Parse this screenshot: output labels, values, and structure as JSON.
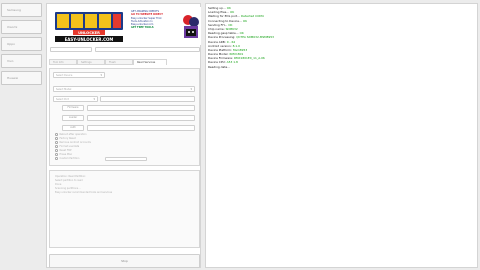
{
  "sidebar": {
    "items": [
      {
        "label": "Samsung"
      },
      {
        "label": "Xiaomi"
      },
      {
        "label": "Oppo"
      },
      {
        "label": "Vivo"
      },
      {
        "label": "Huawei"
      }
    ]
  },
  "banner": {
    "logo_text": "EASY",
    "logo_sub": "UNLOCKER",
    "logo_url": "EASY-UNLOCKER.COM",
    "promo_lines": [
      "GET AMAZING CREDITS",
      "GO TO WEBSITE DIRECT",
      "Easy unlocker Super Trick",
      "Tools Activation In",
      "Easy-unlocker.com"
    ],
    "promo_cta": "GET FREE TOOLS"
  },
  "tabs": {
    "items": [
      {
        "label": "Tool Info"
      },
      {
        "label": "Settings"
      },
      {
        "label": "Flash"
      },
      {
        "label": "Read Services"
      }
    ],
    "active_index": 3
  },
  "settings": {
    "dropdowns": [
      {
        "placeholder": "Select Device"
      },
      {
        "placeholder": "Select Model"
      },
      {
        "placeholder": "Select Port"
      }
    ],
    "buttons": [
      {
        "label": "Firmware"
      },
      {
        "label": "Loader"
      },
      {
        "label": "Auth"
      }
    ],
    "options": [
      {
        "label": "Reboot after operation"
      },
      {
        "label": "Factory Reset"
      },
      {
        "label": "Remove Android Accounts"
      },
      {
        "label": "Format userdata"
      },
      {
        "label": "Reset FRP"
      },
      {
        "label": "Erase Misc"
      },
      {
        "label": "Custom Partition"
      }
    ]
  },
  "info": {
    "lines": [
      "Operation: Read Partition: ",
      "Select partition to read",
      "Done",
      "Scanning partitions...",
      "Easy unlocker recommended tools and services"
    ]
  },
  "stop_button": {
    "label": "Stop"
  },
  "log": {
    "lines": [
      {
        "key": "Setting up...",
        "val": "OK",
        "color": "#12a012"
      },
      {
        "key": "Loading files...",
        "val": "OK",
        "color": "#12a012"
      },
      {
        "key": "Waiting for EDL port...",
        "val": "Detected COM4",
        "color": "#12a012"
      },
      {
        "key": "Connecting to Device...",
        "val": "OK",
        "color": "#12a012"
      },
      {
        "key": "Sending FH...",
        "val": "OK",
        "color": "#12a012"
      },
      {
        "key": "Chip name:",
        "val": "SDM632",
        "color": "#12a012"
      },
      {
        "key": "Reading gasp table...",
        "val": "OK",
        "color": "#12a012"
      },
      {
        "key": "Device Processing:",
        "val": "QCTPA SDM632-MSM8953",
        "color": "#12a012"
      },
      {
        "key": "Device ARB:",
        "val": "0 - 64",
        "color": "#12a012"
      },
      {
        "key": "Android version:",
        "val": "8.1.0",
        "color": "#12a012"
      },
      {
        "key": "Device Platform:",
        "val": "Msm8953",
        "color": "#12a012"
      },
      {
        "key": "Device Model:",
        "val": "RMX1801",
        "color": "#12a012"
      },
      {
        "key": "Device Firmware:",
        "val": "RMX1801EX_11_A.06",
        "color": "#12a012"
      },
      {
        "key": "Device CPU:",
        "val": "A53 1.8",
        "color": "#12a012"
      },
      {
        "key": "Reading data...",
        "val": "",
        "color": "#12a012"
      }
    ]
  }
}
